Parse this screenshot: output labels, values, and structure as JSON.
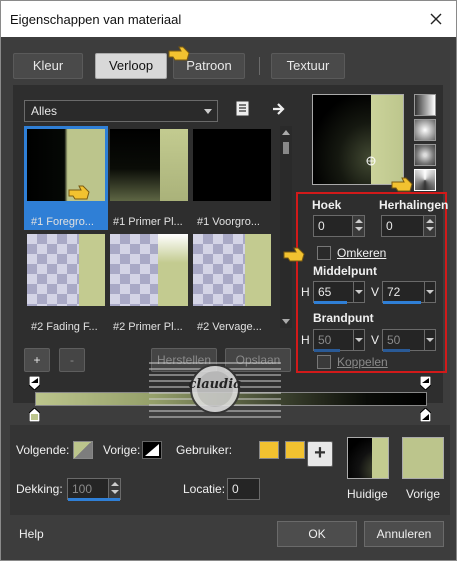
{
  "window": {
    "title": "Eigenschappen van materiaal",
    "close_icon": "close-icon"
  },
  "tabs": [
    {
      "label": "Kleur"
    },
    {
      "label": "Verloop",
      "active": true
    },
    {
      "label": "Patroon"
    },
    {
      "label": "Textuur"
    }
  ],
  "library": {
    "filter_value": "Alles",
    "thumbnails": [
      {
        "label": "#1 Foregro...",
        "selected": true
      },
      {
        "label": "#1 Primer Pl..."
      },
      {
        "label": "#1 Voorgro..."
      },
      {
        "label": "#2 Fading F..."
      },
      {
        "label": "#2 Primer Pl..."
      },
      {
        "label": "#2 Vervage..."
      }
    ],
    "add_label": "+",
    "remove_label": "-",
    "reset_label": "Herstellen",
    "save_label": "Opslaan"
  },
  "settings": {
    "hoek_label": "Hoek",
    "hoek_value": "0",
    "herhalingen_label": "Herhalingen",
    "herhalingen_value": "0",
    "omkeren_label": "Omkeren",
    "middelpunt_label": "Middelpunt",
    "h_label": "H",
    "v_label": "V",
    "middel_h": "65",
    "middel_v": "72",
    "brandpunt_label": "Brandpunt",
    "brand_h": "50",
    "brand_v": "50",
    "koppelen_label": "Koppelen"
  },
  "bottom": {
    "volgende_label": "Volgende:",
    "vorige_label": "Vorige:",
    "gebruiker_label": "Gebruiker:",
    "dekking_label": "Dekking:",
    "dekking_value": "100",
    "locatie_label": "Locatie:",
    "locatie_value": "0",
    "plus_label": "+",
    "huidige_label": "Huidige",
    "vorige_preview_label": "Vorige"
  },
  "footer": {
    "help_label": "Help",
    "ok_label": "OK",
    "cancel_label": "Annuleren"
  },
  "watermark": {
    "text": "claudia"
  },
  "colors": {
    "accent": "#2f7fd6",
    "highlight": "#d21a1a",
    "gradient_light": "#bcc58c",
    "user_swatch": "#f2c230"
  }
}
